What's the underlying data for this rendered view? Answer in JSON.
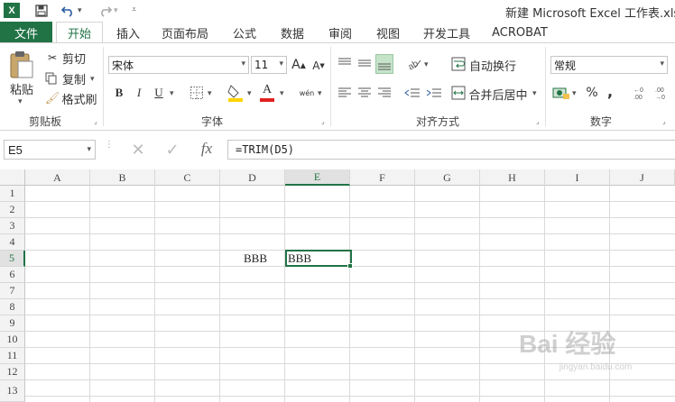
{
  "title_bar": {
    "app_icon": "X",
    "save_icon": "save-icon",
    "undo_icon": "undo-icon",
    "redo_icon": "redo-icon",
    "title": "新建 Microsoft Excel 工作表.xlsx"
  },
  "tabs": [
    "文件",
    "开始",
    "插入",
    "页面布局",
    "公式",
    "数据",
    "审阅",
    "视图",
    "开发工具",
    "ACROBAT"
  ],
  "ribbon": {
    "clipboard": {
      "paste": "粘贴",
      "cut": "剪切",
      "copy": "复制",
      "format_painter": "格式刷",
      "label": "剪贴板"
    },
    "font": {
      "name": "宋体",
      "size": "11",
      "grow": "A",
      "shrink": "A",
      "bold": "B",
      "italic": "I",
      "underline": "U",
      "pinyin": "wén",
      "font_color": "A",
      "label": "字体"
    },
    "alignment": {
      "wrap_text": "自动换行",
      "merge_center": "合并后居中",
      "label": "对齐方式"
    },
    "number": {
      "format": "常规",
      "percent": "%",
      "comma": ",",
      "label": "数字"
    }
  },
  "formula_bar": {
    "name_box": "E5",
    "fx": "fx",
    "formula": "=TRIM(D5)"
  },
  "sheet": {
    "columns": [
      "A",
      "B",
      "C",
      "D",
      "E",
      "F",
      "G",
      "H",
      "I",
      "J"
    ],
    "rows": [
      "1",
      "2",
      "3",
      "4",
      "5",
      "6",
      "7",
      "8",
      "9",
      "10",
      "11",
      "12",
      "13"
    ],
    "cells": {
      "D5": "BBB",
      "E5": "BBB"
    },
    "selected_cell": "E5"
  },
  "watermark": {
    "text": "Bai 经验",
    "sub": "jingyan.baidu.com"
  },
  "colors": {
    "accent": "#217346"
  }
}
